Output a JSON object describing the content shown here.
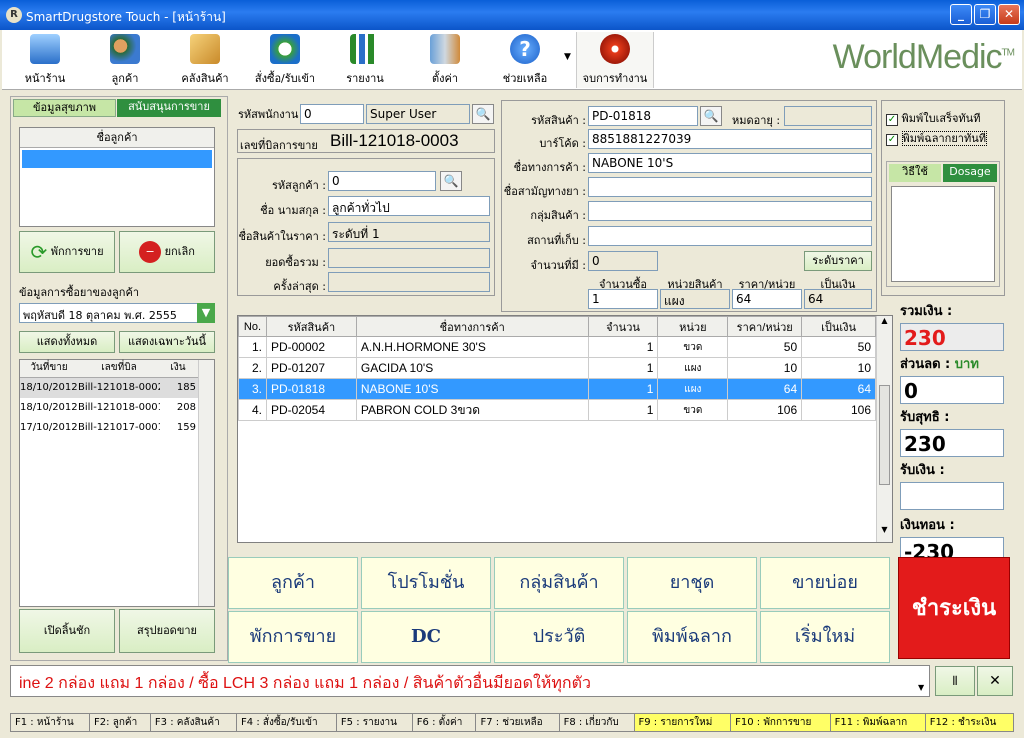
{
  "window": {
    "title": "SmartDrugstore Touch - [หน้าร้าน]"
  },
  "toolbar": {
    "items": [
      {
        "label": "หน้าร้าน",
        "icon": "monitor-icon"
      },
      {
        "label": "ลูกค้า",
        "icon": "users-icon"
      },
      {
        "label": "คลังสินค้า",
        "icon": "warehouse-icon"
      },
      {
        "label": "สั่งซื้อ/รับเข้า",
        "icon": "refresh-icon"
      },
      {
        "label": "รายงาน",
        "icon": "chart-icon"
      },
      {
        "label": "ตั้งค่า",
        "icon": "tools-icon"
      },
      {
        "label": "ช่วยเหลือ",
        "icon": "help-icon"
      },
      {
        "label": "จบการทำงาน",
        "icon": "power-icon"
      }
    ],
    "logo": "WorldMedic",
    "logo_tm": "TM"
  },
  "left": {
    "tab1": "ข้อมูลสุขภาพ",
    "tab2": "สนับสนุนการขาย",
    "customer_header": "ชื่อลูกค้า",
    "pause_btn": "พักการขาย",
    "cancel_btn": "ยกเลิก",
    "history_title": "ข้อมูลการซื้อยาของลูกค้า",
    "date_value": "พฤหัสบดี 18  ตุลาคม  พ.ศ. 2555",
    "show_all": "แสดงทั้งหมด",
    "show_today": "แสดงเฉพาะวันนี้",
    "history_cols": [
      "วันที่ขาย",
      "เลขที่บิล",
      "เงิน"
    ],
    "history_rows": [
      [
        "18/10/2012",
        "Bill-121018-0002",
        "185"
      ],
      [
        "18/10/2012",
        "Bill-121018-0001",
        "208"
      ],
      [
        "17/10/2012",
        "Bill-121017-0001",
        "159"
      ]
    ],
    "open_drawer": "เปิดลิ้นชัก",
    "summary": "สรุปยอดขาย"
  },
  "sale": {
    "emp_label": "รหัสพนักงาน",
    "emp_code": "0",
    "emp_name": "Super User",
    "bill_label": "เลขที่บิลการขาย",
    "bill_no": "Bill-121018-0003",
    "cust_code_label": "รหัสลูกค้า :",
    "cust_code": "0",
    "cust_name_label": "ชื่อ นามสกุล :",
    "cust_name": "ลูกค้าทั่วไป",
    "price_level_label": "ชื่อสินค้าในราคา :",
    "price_level": "ระดับที่ 1",
    "total_label": "ยอดซื้อรวม :",
    "total": "",
    "last_label": "ครั้งล่าสุด :",
    "last": ""
  },
  "product": {
    "code_label": "รหัสสินค้า :",
    "code": "PD-01818",
    "expire_label": "หมดอายุ :",
    "expire": "",
    "barcode_label": "บาร์โค้ด :",
    "barcode": "8851881227039",
    "trade_label": "ชื่อทางการค้า :",
    "trade": "NABONE 10'S",
    "generic_label": "ชื่อสามัญทางยา :",
    "generic": "",
    "group_label": "กลุ่มสินค้า :",
    "group": "",
    "location_label": "สถานที่เก็บ :",
    "location": "",
    "stock_label": "จำนวนที่มี :",
    "stock": "0",
    "price_level_btn": "ระดับราคา",
    "qty_label": "จำนวนซื้อ",
    "qty": "1",
    "unit_label": "หน่วยสินค้า",
    "unit": "แผง",
    "price_label": "ราคา/หน่วย",
    "price": "64",
    "amount_label": "เป็นเงิน",
    "amount": "64"
  },
  "options": {
    "print_receipt": "พิมพ์ใบเสร็จทันที",
    "print_label": "พิมพ์ฉลากยาทันที",
    "tab_use": "วิธีใช้",
    "tab_dosage": "Dosage"
  },
  "grid": {
    "cols": [
      "No.",
      "รหัสสินค้า",
      "ชื่อทางการค้า",
      "จำนวน",
      "หน่วย",
      "ราคา/หน่วย",
      "เป็นเงิน"
    ],
    "rows": [
      [
        "1.",
        "PD-00002",
        "A.N.H.HORMONE 30'S",
        "1",
        "ขวด",
        "50",
        "50"
      ],
      [
        "2.",
        "PD-01207",
        "GACIDA 10'S",
        "1",
        "แผง",
        "10",
        "10"
      ],
      [
        "3.",
        "PD-01818",
        "NABONE 10'S",
        "1",
        "แผง",
        "64",
        "64"
      ],
      [
        "4.",
        "PD-02054",
        "PABRON COLD 3ขวด",
        "1",
        "ขวด",
        "106",
        "106"
      ]
    ]
  },
  "totals": {
    "sum_label": "รวมเงิน :",
    "sum": "230",
    "discount_label": "ส่วนลด :",
    "discount_unit": "บาท",
    "discount": "0",
    "net_label": "รับสุทธิ :",
    "net": "230",
    "paid_label": "รับเงิน :",
    "paid": "",
    "change_label": "เงินทอน :",
    "change": "-230"
  },
  "buttons": {
    "row1": [
      "ลูกค้า",
      "โปรโมชั่น",
      "กลุ่มสินค้า",
      "ยาชุด",
      "ขายบ่อย"
    ],
    "row2": [
      "พักการขาย",
      "DC",
      "ประวัติ",
      "พิมพ์ฉลาก",
      "เริ่มใหม่"
    ],
    "pay": "ชำระเงิน"
  },
  "marquee": "ine 2 กล่อง แถม 1 กล่อง / ซื้อ LCH 3 กล่อง แถม 1 กล่อง / สินค้าตัวอื่นมียอดให้ทุกตัว",
  "status": [
    "F1 : หน้าร้าน",
    "F2: ลูกค้า",
    "F3 : คลังสินค้า",
    "F4 : สั่งซื้อ/รับเข้า",
    "F5 : รายงาน",
    "F6 : ตั้งค่า",
    "F7 : ช่วยเหลือ",
    "F8 : เกี่ยวกับ",
    "F9 : รายการใหม่",
    "F10 : พักการขาย",
    "F11 : พิมพ์ฉลาก",
    "F12 : ชำระเงิน"
  ],
  "colors": {
    "accent_red": "#e31b1b",
    "selected": "#3399ff",
    "yellow": "#ffff66"
  }
}
